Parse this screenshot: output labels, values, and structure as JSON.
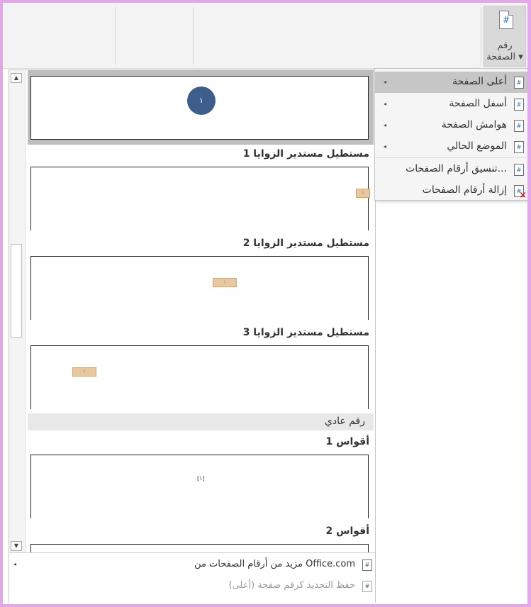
{
  "ribbon": {
    "page_number_button_line1": "رقم",
    "page_number_button_line2": "الصفحة ▾",
    "page_icon_glyph": "#"
  },
  "submenu": {
    "items": [
      {
        "label": "أعلى الصفحة",
        "icon": "page-top-icon",
        "has_submenu": true,
        "highlighted": true
      },
      {
        "label": "أسفل الصفحة",
        "icon": "page-bottom-icon",
        "has_submenu": true
      },
      {
        "label": "هوامش الصفحة",
        "icon": "page-margins-icon",
        "has_submenu": true
      },
      {
        "label": "الموضع الحالي",
        "icon": "current-position-icon",
        "has_submenu": true
      },
      {
        "label": "تنسيق أرقام الصفحات...",
        "icon": "format-page-numbers-icon"
      },
      {
        "label": "إزالة أرقام الصفحات",
        "icon": "remove-page-numbers-icon"
      }
    ],
    "arrow": "◂",
    "icon_glyph": "#"
  },
  "gallery": {
    "selected_preview_number": "١",
    "items": [
      {
        "label": "مستطيل مستدير الزوايا 1",
        "tag": "١"
      },
      {
        "label": "مستطيل مستدير الزوايا 2",
        "tag": "١"
      },
      {
        "label": "مستطيل مستدير الزوايا 3",
        "tag": "١"
      }
    ],
    "category_header": "رقم عادي",
    "category_items": [
      {
        "label": "أقواس 1",
        "number": "[١]"
      },
      {
        "label": "أقواس 2"
      }
    ],
    "scroll_up": "▲",
    "scroll_down": "▼"
  },
  "footer": {
    "more_label": "مزيد من أرقام الصفحات من Office.com",
    "save_label": "حفظ التحديد كرقم صفحة (أعلى)",
    "arrow": "◂"
  },
  "colors": {
    "window_border": "#e3a6e6",
    "highlight": "#c6c6c6",
    "circle_fill": "#3d5e8c",
    "tag_fill": "#e6c9a0"
  }
}
